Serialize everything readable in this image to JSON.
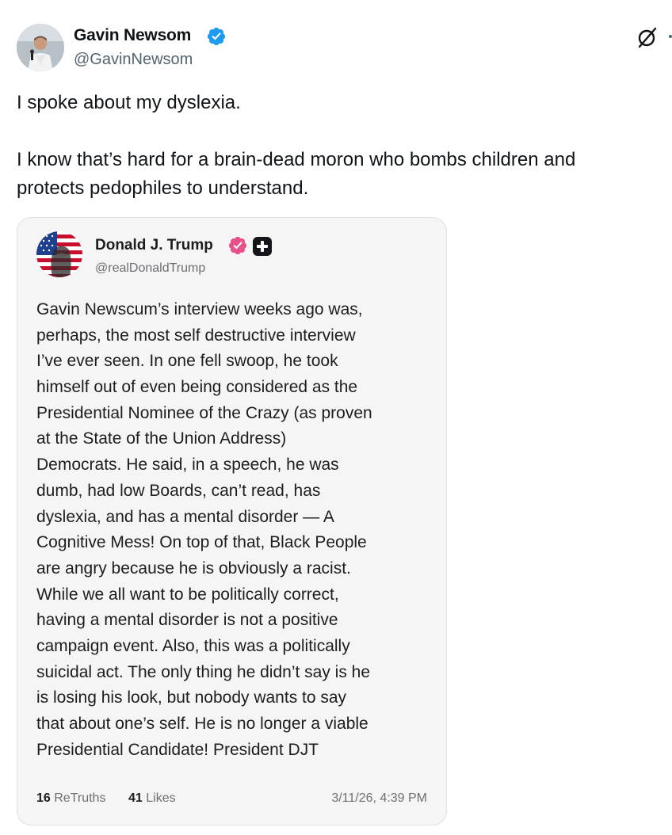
{
  "author": {
    "name": "Gavin Newsom",
    "handle": "@GavinNewsom",
    "verified_color": "#1d9bf0"
  },
  "tweet": {
    "text_line1": "I spoke about my dyslexia.",
    "text_line2": "I know that’s hard for a brain-dead moron who bombs children and",
    "text_line3": "protects pedophiles to understand."
  },
  "quoted_post": {
    "name": "Donald J. Trump",
    "handle": "@realDonaldTrump",
    "badge_color": "#e8508a",
    "body_lines": [
      "Gavin Newscum’s interview weeks ago was,",
      "perhaps, the most self destructive interview",
      "I’ve ever seen. In one fell swoop, he took",
      "himself out of even being considered as the",
      "Presidential Nominee of the Crazy (as proven",
      "at the State of the Union Address)",
      "Democrats. He said, in a speech, he was",
      "dumb, had low Boards, can’t read, has",
      "dyslexia, and has a mental disorder — A",
      "Cognitive Mess! On top of that, Black People",
      "are angry because he is obviously a racist.",
      "While we all want to be politically correct,",
      "having a mental disorder is not a positive",
      "campaign event. Also, this was a politically",
      "suicidal act. The only thing he didn’t say is he",
      "is losing his look, but nobody wants to say",
      "that about one’s self. He is no longer a viable",
      "Presidential Candidate! President DJT"
    ],
    "retruths_count": "16",
    "retruths_label": "ReTruths",
    "likes_count": "41",
    "likes_label": "Likes",
    "timestamp": "3/11/26, 4:39 PM"
  },
  "icons": {
    "verified": "verified-check-icon",
    "grok": "grok-icon",
    "truth_plus": "plus-icon"
  }
}
